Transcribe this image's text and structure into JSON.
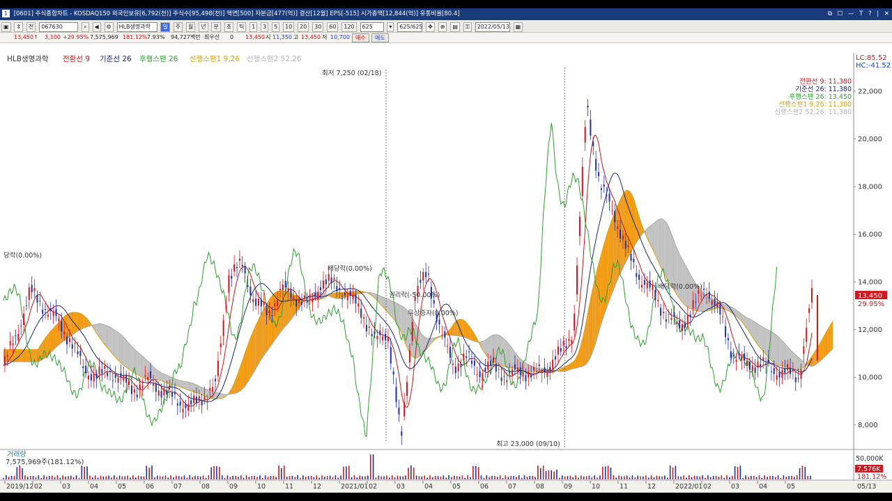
{
  "window": {
    "title": "[0601] 주식종합차트 - KOSDAQ150 외국인보유[6,792(천)] 주식수[95,498(천)] 액면[500] 자본금[477(억)] 결산[12월] EPS[-515] 시가총액[12,844(억)] 유통비율[80.4]",
    "screen_no": "1",
    "controls": [
      "⧉",
      "☐",
      "—",
      "T",
      "?",
      "|",
      "✕"
    ]
  },
  "toolbar": {
    "code_prefix": "전",
    "stock_code": "067630",
    "stock_name": "HLB생명과학",
    "period_buttons": [
      "주",
      "월",
      "년",
      "분",
      "초",
      "틱"
    ],
    "interval_buttons": [
      "1",
      "3",
      "5",
      "10",
      "20",
      "30",
      "60",
      "120"
    ],
    "count_value": "625",
    "count_total": "625/625",
    "date_value": "2022/05/13"
  },
  "quote": {
    "price": "13,450",
    "arrow": "↑",
    "change": "3,100",
    "change_pct": "+29.95%",
    "volume": "7,575,969",
    "volume_ratio": "181.12%",
    "turnover": "7.93%",
    "amount": "94,727백만",
    "pref_label": "최우선",
    "pref_value": "0",
    "ask": "13,450",
    "open_label": "시",
    "open": "11,350",
    "high_label": "고",
    "high": "13,450",
    "low_label": "저",
    "low": "10,700",
    "buy_label": "매수",
    "sell_label": "매도"
  },
  "chart_data": {
    "type": "line",
    "title": "HLB생명과학",
    "legend": [
      {
        "name": "전환선 9",
        "color": "#c21616"
      },
      {
        "name": "기준선 26",
        "color": "#1c2470"
      },
      {
        "name": "후행스팬 26",
        "color": "#2e9e2e"
      },
      {
        "name": "선행스팬1 9,26",
        "color": "#d8a312"
      },
      {
        "name": "선행스팬2 52,26",
        "color": "#b5b5b5"
      }
    ],
    "right_legend": [
      {
        "label": "전환선 9: 11,380",
        "color": "#c21616"
      },
      {
        "label": "기준선 26: 11,380",
        "color": "#1c2470"
      },
      {
        "label": "후행스팬 26: 13,450",
        "color": "#2e9e2e"
      },
      {
        "label": "선행스팬1 9,26: 11,380",
        "color": "#d8a312"
      },
      {
        "label": "선행스팬2 52,26: 11,380",
        "color": "#b5b5b5"
      }
    ],
    "y_axis": {
      "ticks": [
        "22,000",
        "20,000",
        "18,000",
        "16,000",
        "14,000",
        "12,000",
        "10,000",
        "8,000"
      ],
      "ylim": [
        7000,
        23200
      ]
    },
    "lc_label": "LC:85.52",
    "hc_label": "HC:-41.52",
    "x_axis": {
      "ticks": [
        "2019/12",
        "02",
        "03",
        "04",
        "05",
        "06",
        "07",
        "08",
        "09",
        "10",
        "11",
        "12",
        "2021/01",
        "02",
        "03",
        "04",
        "05",
        "06",
        "07",
        "08",
        "09",
        "10",
        "11",
        "12",
        "2022/01",
        "02",
        "03",
        "04",
        "05"
      ],
      "end_label": "05/13"
    },
    "price_series": {
      "name": "종가",
      "values": [
        10500,
        11800,
        13600,
        13000,
        12400,
        11600,
        10400,
        10000,
        10300,
        9800,
        9500,
        9900,
        9400,
        9100,
        8700,
        9200,
        9600,
        14300,
        14700,
        13100,
        12700,
        13700,
        13400,
        13000,
        14000,
        13900,
        13400,
        12800,
        11500,
        11900,
        7300,
        13400,
        14400,
        11800,
        10500,
        10800,
        10200,
        10500,
        10000,
        10300,
        10100,
        10400,
        11000,
        12000,
        21500,
        18000,
        17000,
        15300,
        14200,
        13500,
        12600,
        12100,
        12900,
        13800,
        12700,
        11000,
        10500,
        10600,
        10300,
        10200,
        10000,
        13450
      ]
    },
    "max_annotation": {
      "text": "최고 23,000 (09/10)",
      "value": 23000
    },
    "min_annotation": {
      "text": "최저 7,250 (02/18)",
      "value": 7250
    },
    "event_labels": [
      "당락(0.00%)",
      "배당락(0.00%)",
      "권리락(-50.00%)",
      "무상증자(0.00%)",
      "배당락(0.00%)"
    ],
    "last_price_label": "13,450",
    "last_change_label": "29.95%"
  },
  "volume_panel": {
    "title": "거래량",
    "value_label": "7,575,969주(181.12%)",
    "axis_label": "50,000K",
    "last_label": "7,576K",
    "last_ratio": "181.12%"
  }
}
